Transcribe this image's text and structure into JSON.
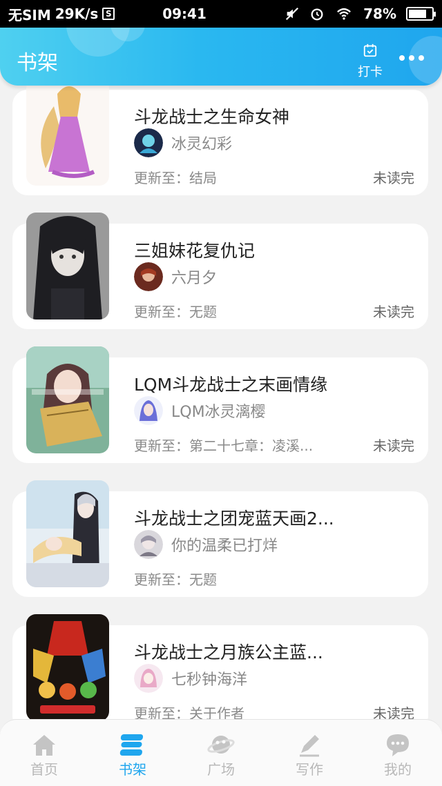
{
  "status_bar": {
    "carrier": "无SIM",
    "speed": "29K/s",
    "sim_box": "S",
    "time": "09:41",
    "battery": "78%",
    "battery_level": 0.78
  },
  "header": {
    "title": "书架",
    "checkin_label": "打卡",
    "accent": "#1fa6ee"
  },
  "books": [
    {
      "title": "斗龙战士之生命女神",
      "author": "冰灵幻彩",
      "update": "更新至：结局",
      "status": "未读完"
    },
    {
      "title": "三姐妹花复仇记",
      "author": "六月夕",
      "update": "更新至：无题",
      "status": "未读完"
    },
    {
      "title": "LQM斗龙战士之末画情缘",
      "author": "LQM冰灵漓樱",
      "update": "更新至：第二十七章：凌溪...",
      "status": "未读完"
    },
    {
      "title": "斗龙战士之团宠蓝天画2...",
      "author": "你的温柔已打烊",
      "update": "更新至：无题",
      "status": ""
    },
    {
      "title": "斗龙战士之月族公主蓝...",
      "author": "七秒钟海洋",
      "update": "更新至：关于作者",
      "status": "未读完"
    }
  ],
  "bottom_nav": [
    {
      "label": "首页",
      "icon": "home-icon",
      "active": false
    },
    {
      "label": "书架",
      "icon": "bookshelf-icon",
      "active": true
    },
    {
      "label": "广场",
      "icon": "planet-icon",
      "active": false
    },
    {
      "label": "写作",
      "icon": "pen-icon",
      "active": false
    },
    {
      "label": "我的",
      "icon": "chat-bubble-icon",
      "active": false
    }
  ]
}
